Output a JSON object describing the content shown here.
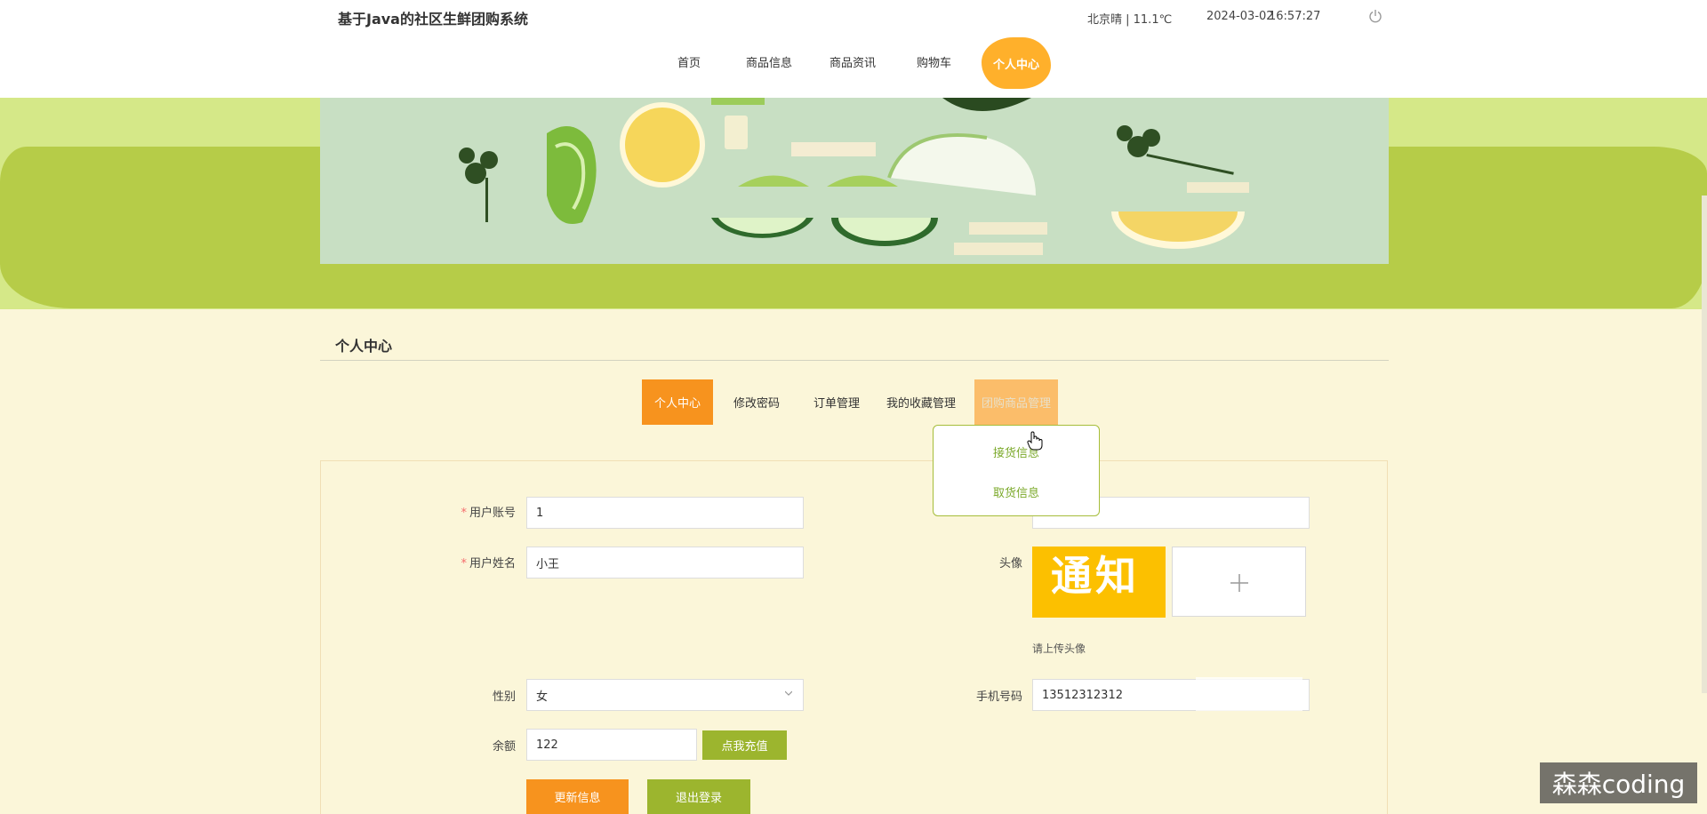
{
  "header": {
    "title": "基于Java的社区生鲜团购系统",
    "weather": "北京晴 | 11.1℃",
    "date": "2024-03-02",
    "time": "16:57:27"
  },
  "nav": {
    "items": [
      "首页",
      "商品信息",
      "商品资讯",
      "购物车"
    ],
    "active": "个人中心"
  },
  "section": {
    "title": "个人中心",
    "tabs": [
      "个人中心",
      "修改密码",
      "订单管理",
      "我的收藏管理",
      "团购商品管理"
    ]
  },
  "dropdown": {
    "items": [
      "接货信息",
      "取货信息"
    ]
  },
  "form": {
    "account_label": "用户账号",
    "account_value": "1",
    "name_label": "用户姓名",
    "name_value": "小王",
    "avatar_label": "头像",
    "avatar_text": "通知",
    "upload_symbol": "+",
    "upload_hint": "请上传头像",
    "gender_label": "性别",
    "gender_value": "女",
    "phone_label": "手机号码",
    "phone_value": "13512312312",
    "balance_label": "余额",
    "balance_value": "122",
    "recharge_button": "点我充值",
    "update_button": "更新信息",
    "logout_button": "退出登录",
    "required_mark": "*"
  },
  "watermark": "森森coding",
  "colors": {
    "accent_orange": "#f7931e",
    "accent_green": "#9cb52e",
    "banner_light": "#d5e888",
    "banner_dark": "#b6cc48",
    "page_bg": "#fbf6d9"
  }
}
